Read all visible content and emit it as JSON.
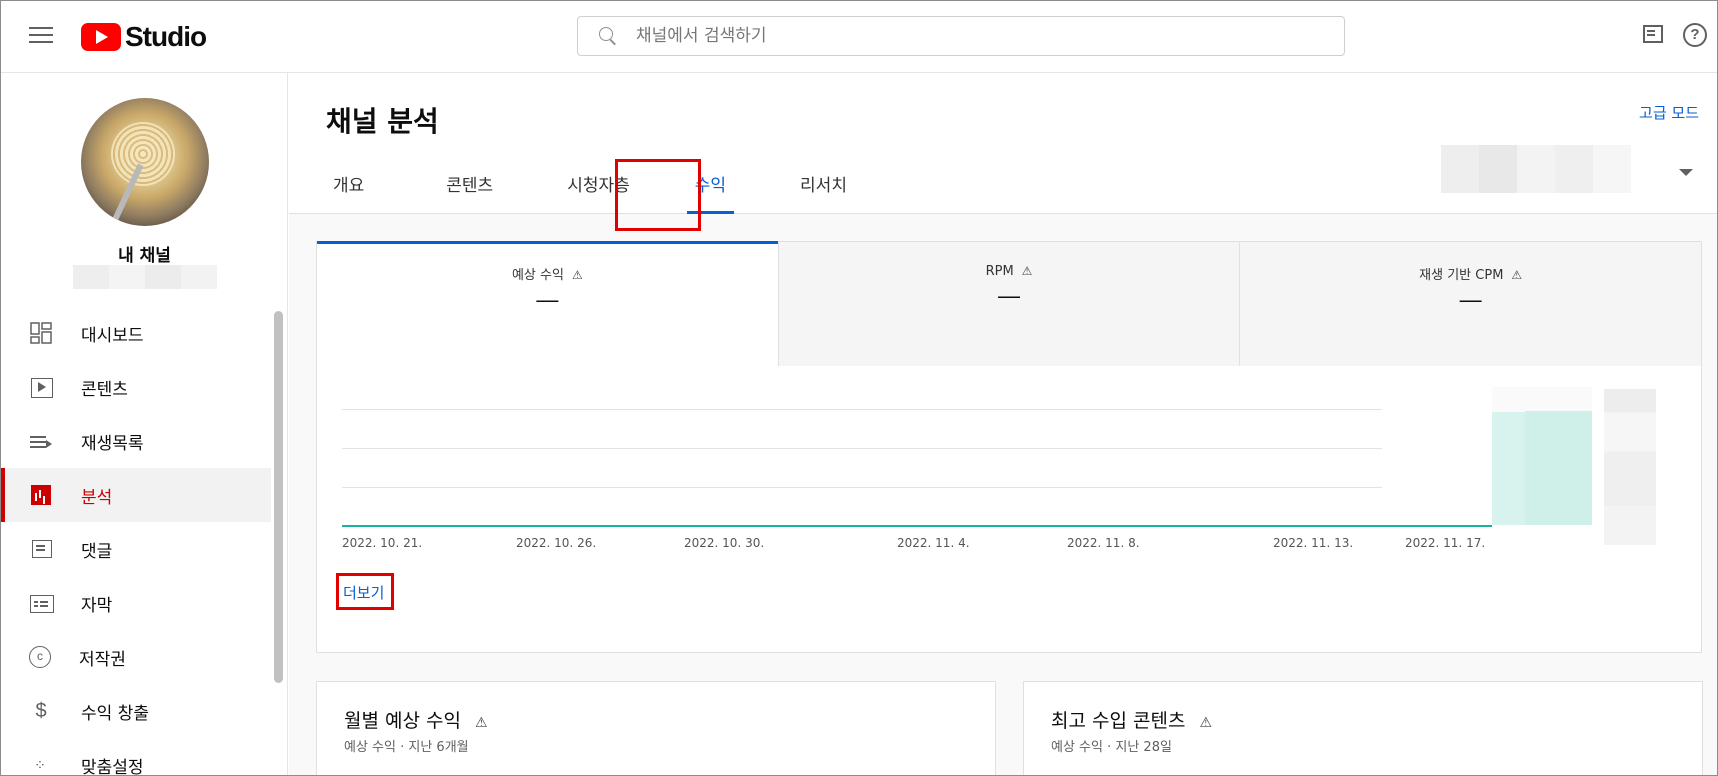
{
  "header": {
    "logo_text": "Studio",
    "search_placeholder": "채널에서 검색하기",
    "help_glyph": "?"
  },
  "sidebar": {
    "channel_name": "내 채널",
    "items": [
      {
        "label": "대시보드",
        "icon": "dashboard-icon"
      },
      {
        "label": "콘텐츠",
        "icon": "content-icon"
      },
      {
        "label": "재생목록",
        "icon": "playlist-icon"
      },
      {
        "label": "분석",
        "icon": "analytics-icon",
        "active": true
      },
      {
        "label": "댓글",
        "icon": "comment-icon"
      },
      {
        "label": "자막",
        "icon": "subtitles-icon"
      },
      {
        "label": "저작권",
        "icon": "copyright-icon",
        "glyph": "c"
      },
      {
        "label": "수익 창출",
        "icon": "monetization-icon",
        "glyph": "$"
      },
      {
        "label": "맞춤설정",
        "icon": "customization-icon",
        "glyph": "⁘"
      }
    ]
  },
  "main": {
    "title": "채널 분석",
    "advanced_mode": "고급 모드",
    "tabs": [
      "개요",
      "콘텐츠",
      "시청자층",
      "수익",
      "리서치"
    ],
    "active_tab": "수익"
  },
  "metrics": [
    {
      "title": "예상 수익",
      "value": "—",
      "warn": "⚠"
    },
    {
      "title": "RPM",
      "value": "—",
      "warn": "⚠"
    },
    {
      "title": "재생 기반 CPM",
      "value": "—",
      "warn": "⚠"
    }
  ],
  "chart_data": {
    "type": "line",
    "title": "",
    "xlabel": "",
    "ylabel": "",
    "x": [
      "2022. 10. 21.",
      "2022. 10. 26.",
      "2022. 10. 30.",
      "2022. 11. 4.",
      "2022. 11. 8.",
      "2022. 11. 13.",
      "2022. 11. 17."
    ],
    "series": [
      {
        "values": [
          0,
          0,
          0,
          0,
          0,
          0,
          0
        ]
      }
    ],
    "grid": true,
    "color": "#16b29e"
  },
  "more_link": "더보기",
  "cards": [
    {
      "title": "월별 예상 수익",
      "subtitle": "예상 수익 · 지난 6개월",
      "warn": "⚠"
    },
    {
      "title": "최고 수입 콘텐츠",
      "subtitle": "예상 수익 · 지난 28일",
      "warn": "⚠"
    }
  ],
  "colors": {
    "accent": "#065fd4",
    "brand": "#ff0000",
    "highlight": "#e00000",
    "series": "#16b29e"
  }
}
